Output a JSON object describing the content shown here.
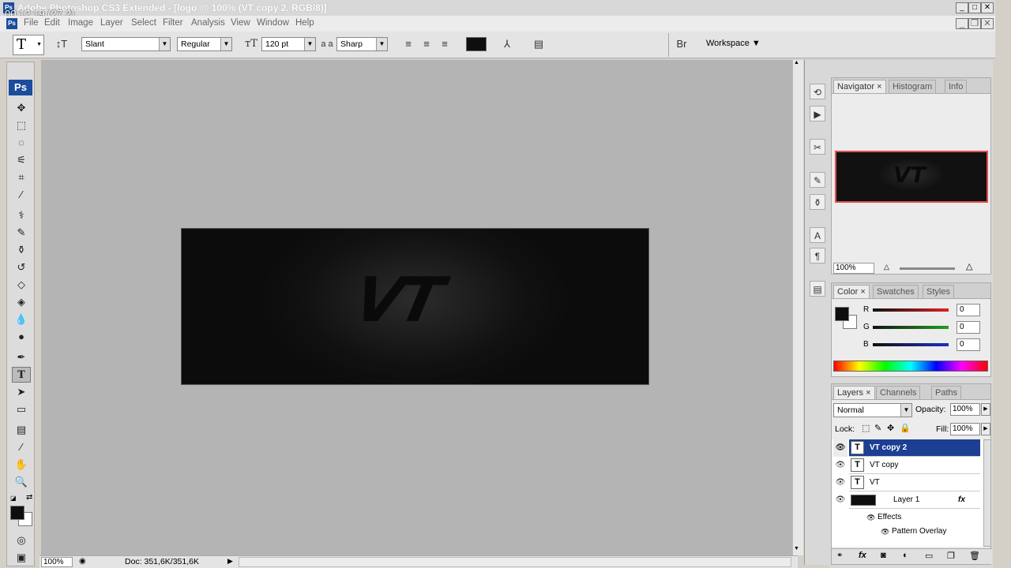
{
  "window": {
    "title": "Adobe Photoshop CS3 Extended - [logo @ 100% (VT copy 2, RGB/8)]",
    "recording_time": "00:12:19 (27.2)",
    "app_icon": "Ps"
  },
  "menu": [
    "File",
    "Edit",
    "Image",
    "Layer",
    "Select",
    "Filter",
    "Analysis",
    "View",
    "Window",
    "Help"
  ],
  "options": {
    "font_family": "Slant",
    "font_style": "Regular",
    "font_size": "120 pt",
    "antialias_label": "a a",
    "antialias": "Sharp",
    "workspace": "Workspace"
  },
  "canvas": {
    "text": "VT"
  },
  "status": {
    "zoom": "100%",
    "doc": "Doc: 351,6K/351,6K"
  },
  "navigator": {
    "tabs": [
      "Navigator",
      "Histogram",
      "Info"
    ],
    "zoom": "100%",
    "thumb_text": "VT"
  },
  "color": {
    "tabs": [
      "Color",
      "Swatches",
      "Styles"
    ],
    "r_label": "R",
    "g_label": "G",
    "b_label": "B",
    "r": "0",
    "g": "0",
    "b": "0",
    "r_color": "#e02020",
    "g_color": "#20a020",
    "b_color": "#2030c0"
  },
  "layers": {
    "tabs": [
      "Layers",
      "Channels",
      "Paths"
    ],
    "blend_mode": "Normal",
    "opacity_label": "Opacity:",
    "opacity": "100%",
    "lock_label": "Lock:",
    "fill_label": "Fill:",
    "fill": "100%",
    "items": [
      {
        "name": "VT copy 2",
        "type": "T",
        "selected": true
      },
      {
        "name": "VT copy",
        "type": "T",
        "selected": false
      },
      {
        "name": "VT",
        "type": "T",
        "selected": false
      },
      {
        "name": "Layer 1",
        "type": "image",
        "selected": false
      }
    ],
    "effects_label": "Effects",
    "pattern_overlay": "Pattern Overlay",
    "fx_badge": "fx"
  }
}
